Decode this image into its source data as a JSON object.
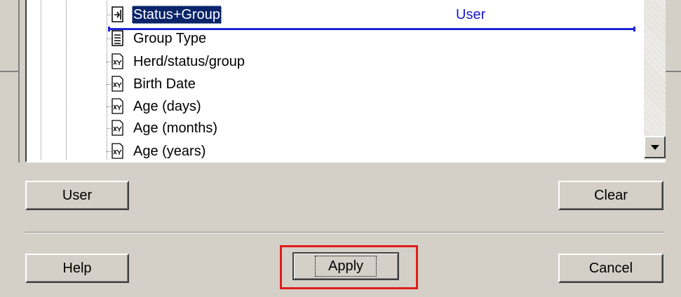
{
  "tree": {
    "user_tag": "User",
    "items": [
      {
        "label": "Status+Group",
        "icon": "relation-icon",
        "selected": true
      },
      {
        "label": "Group Type",
        "icon": "document-icon",
        "selected": false
      },
      {
        "label": "Herd/status/group",
        "icon": "field-xyz-icon",
        "selected": false
      },
      {
        "label": "Birth Date",
        "icon": "field-xyz-icon",
        "selected": false
      },
      {
        "label": "Age (days)",
        "icon": "field-xyz-icon",
        "selected": false
      },
      {
        "label": "Age (months)",
        "icon": "field-xyz-icon",
        "selected": false
      },
      {
        "label": "Age (years)",
        "icon": "field-xyz-icon",
        "selected": false
      }
    ]
  },
  "buttons": {
    "user": "User",
    "clear": "Clear",
    "help": "Help",
    "apply": "Apply",
    "cancel": "Cancel"
  },
  "colors": {
    "selection": "#0a246a",
    "drop_line": "#1f23d6",
    "highlight": "#e01c1c",
    "face": "#d4d0c8"
  }
}
